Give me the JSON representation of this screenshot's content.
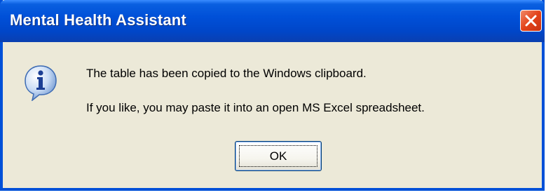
{
  "window": {
    "title": "Mental Health Assistant",
    "close_icon": "close-icon"
  },
  "dialog": {
    "icon": "info-icon",
    "message_line1": "The table has been copied to the Windows clipboard.",
    "message_line2": "If you like, you may paste it into an open MS Excel spreadsheet.",
    "ok_label": "OK"
  },
  "colors": {
    "titlebar": "#0050d8",
    "dialog_background": "#ece9d8",
    "close_button": "#e3431a"
  }
}
